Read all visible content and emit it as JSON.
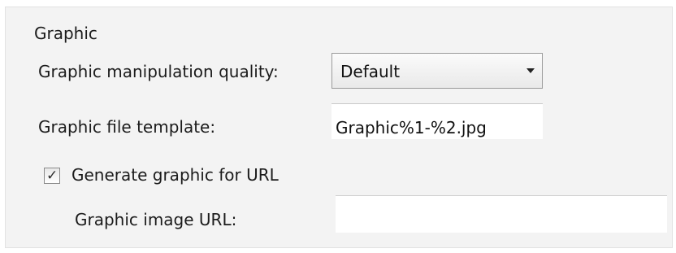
{
  "section": {
    "title": "Graphic"
  },
  "quality": {
    "label": "Graphic manipulation quality:",
    "selected": "Default",
    "arrow_icon": "chevron-down-icon"
  },
  "template": {
    "label": "Graphic file template:",
    "value": "Graphic%1-%2.jpg"
  },
  "generate": {
    "label": "Generate graphic for URL",
    "checked": true,
    "check_glyph": "✓"
  },
  "url": {
    "label": "Graphic image URL:",
    "value": ""
  }
}
